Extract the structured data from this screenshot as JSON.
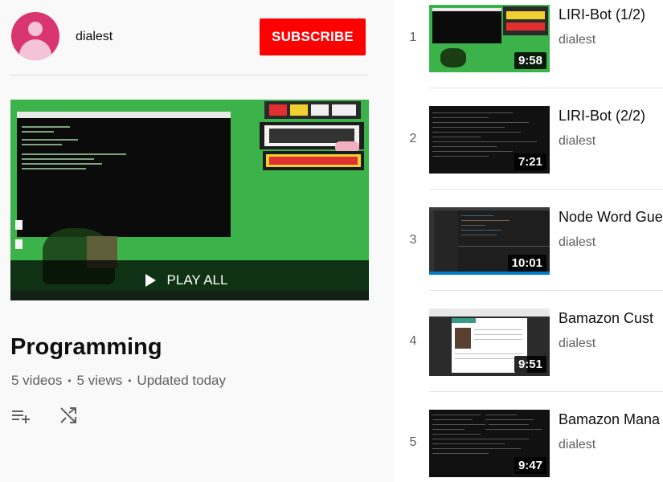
{
  "owner": {
    "name": "dialest",
    "subscribe_label": "SUBSCRIBE"
  },
  "hero": {
    "play_all_label": "PLAY ALL"
  },
  "playlist": {
    "title": "Programming",
    "video_count": "5 videos",
    "view_count": "5 views",
    "updated": "Updated today"
  },
  "videos": [
    {
      "index": "1",
      "title": "LIRI-Bot (1/2)",
      "owner": "dialest",
      "duration": "9:58"
    },
    {
      "index": "2",
      "title": "LIRI-Bot (2/2)",
      "owner": "dialest",
      "duration": "7:21"
    },
    {
      "index": "3",
      "title": "Node Word Gue",
      "owner": "dialest",
      "duration": "10:01"
    },
    {
      "index": "4",
      "title": "Bamazon Cust",
      "owner": "dialest",
      "duration": "9:51"
    },
    {
      "index": "5",
      "title": "Bamazon Mana",
      "owner": "dialest",
      "duration": "9:47"
    }
  ],
  "colors": {
    "subscribe": "#ff0000",
    "avatar": "#d93670",
    "thumb_green": "#3cb24a"
  },
  "icons": {
    "add_to_queue": "playlist-add-icon",
    "shuffle": "shuffle-icon",
    "play": "play-icon"
  }
}
